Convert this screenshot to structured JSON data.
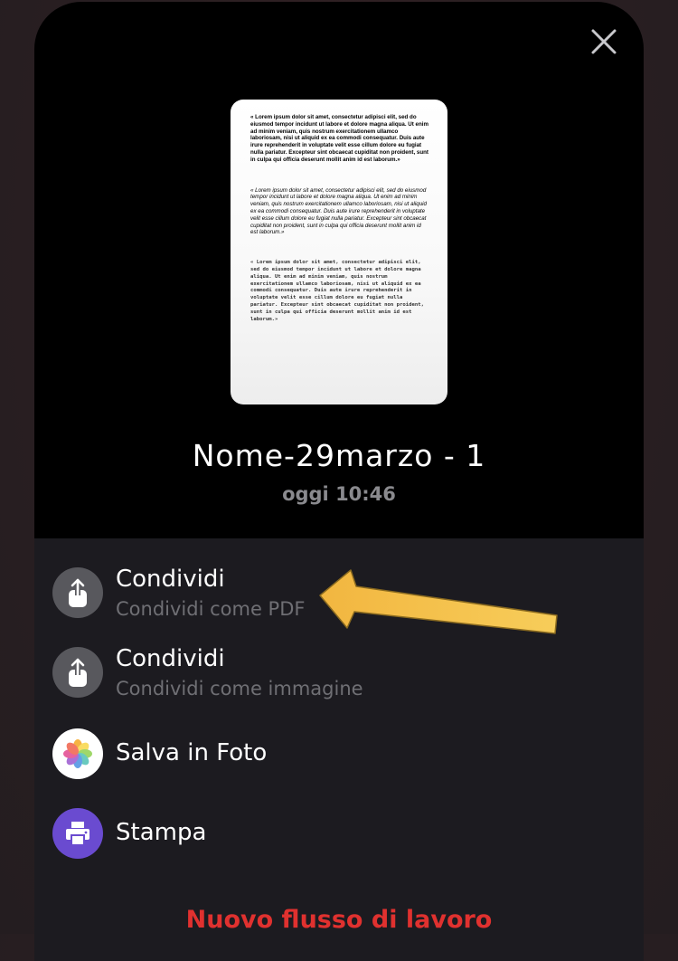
{
  "dialog": {
    "close_icon": "close-icon",
    "document_name": "Nome-29marzo - 1",
    "document_date": "oggi 10:46"
  },
  "preview": {
    "paragraphs": [
      "« Lorem ipsum dolor sit amet, consectetur adipisci elit, sed do eiusmod tempor incidunt ut labore et dolore magna aliqua. Ut enim ad minim veniam, quis nostrum exercitationem ullamco laboriosam, nisi ut aliquid ex ea commodi consequatur. Duis aute irure reprehenderit in voluptate velit esse cillum dolore eu fugiat nulla pariatur. Excepteur sint obcaecat cupiditat non proident, sunt in culpa qui officia deserunt mollit anim id est laborum.»",
      "« Lorem ipsum dolor sit amet, consectetur adipisci elit, sed do eiusmod tempor incidunt ut labore et dolore magna aliqua. Ut enim ad minim veniam, quis nostrum exercitationem ullamco laboriosam, nisi ut aliquid ex ea commodi consequatur. Duis aute irure reprehenderit in voluptate velit esse cillum dolore eu fugiat nulla pariatur. Excepteur sint obcaecat cupiditat non proident, sunt in culpa qui officia deserunt mollit anim id est laborum.»",
      "« Lorem ipsum dolor sit amet, consectetur adipisci elit, sed do eiusmod tempor incidunt ut labore et dolore magna aliqua. Ut enim ad minim veniam, quis nostrum exercitationem ullamco laboriosam, nisi ut aliquid ex ea commodi consequatur. Duis aute irure reprehenderit in voluptate velit esse cillum dolore eu fugiat nulla pariatur. Excepteur sint obcaecat cupiditat non proident, sunt in culpa qui officia deserunt mollit anim id est laborum.»"
    ]
  },
  "actions": [
    {
      "label": "Condividi",
      "subtitle": "Condividi come PDF",
      "icon": "share-icon"
    },
    {
      "label": "Condividi",
      "subtitle": "Condividi come immagine",
      "icon": "share-icon"
    },
    {
      "label": "Salva in Foto",
      "icon": "photos-icon"
    },
    {
      "label": "Stampa",
      "icon": "printer-icon"
    }
  ],
  "footer": {
    "workflow_label": "Nuovo flusso di lavoro"
  },
  "colors": {
    "accent_red": "#e0312f",
    "print_purple": "#6a4bd0",
    "annotation_arrow": "#f5c04a"
  }
}
